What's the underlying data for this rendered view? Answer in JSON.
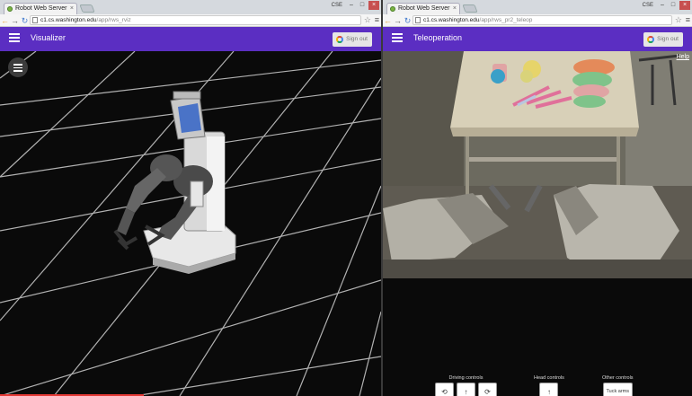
{
  "left_window": {
    "tab_title": "Robot Web Server",
    "user": "CSE",
    "url_host": "c1.cs.washington.edu",
    "url_path": "/app/rws_rviz",
    "app_title": "Visualizer",
    "signout_label": "Sign out"
  },
  "right_window": {
    "tab_title": "Robot Web Server",
    "user": "CSE",
    "url_host": "c1.cs.washington.edu",
    "url_path": "/app/rws_pr2_teleop",
    "app_title": "Teleoperation",
    "signout_label": "Sign out",
    "help_label": "Help",
    "controls": {
      "driving_title": "Driving controls",
      "driving_buttons": [
        "⟲",
        "↑",
        "⟳"
      ],
      "head_title": "Head controls",
      "head_buttons": [
        "↑"
      ],
      "other_title": "Other controls",
      "tuck_arms_label": "Tuck arms"
    }
  },
  "colors": {
    "appbar": "#5b2ec2",
    "canvas_bg": "#0a0a0a",
    "grid": "#cfcfcf"
  },
  "icons": [
    "favicon",
    "back-arrow-icon",
    "forward-arrow-icon",
    "refresh-icon",
    "star-icon",
    "menu-icon",
    "hamburger-icon",
    "google-icon"
  ]
}
